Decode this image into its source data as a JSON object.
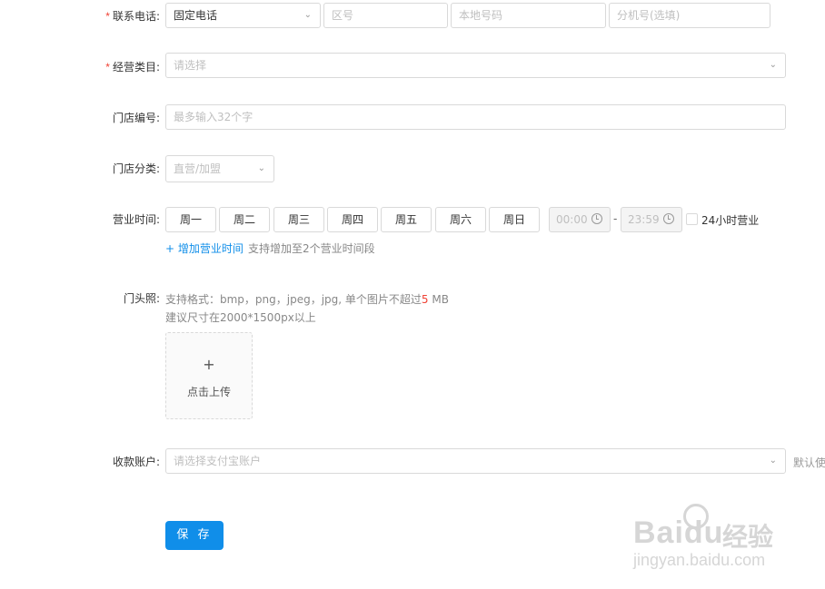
{
  "contact": {
    "label": "联系电话:",
    "required": "*",
    "type_value": "固定电话",
    "area_placeholder": "区号",
    "local_placeholder": "本地号码",
    "ext_placeholder": "分机号(选填)"
  },
  "category": {
    "label": "经营类目:",
    "required": "*",
    "placeholder": "请选择"
  },
  "store_number": {
    "label": "门店编号:",
    "placeholder": "最多输入32个字"
  },
  "store_type": {
    "label": "门店分类:",
    "placeholder": "直营/加盟"
  },
  "hours": {
    "label": "营业时间:",
    "days": [
      "周一",
      "周二",
      "周三",
      "周四",
      "周五",
      "周六",
      "周日"
    ],
    "start": "00:00",
    "dash": "-",
    "end": "23:59",
    "all_day_label": "24小时营业",
    "add_link": "+ 增加营业时间",
    "add_hint": "支持增加至2个营业时间段"
  },
  "photo": {
    "label": "门头照:",
    "format_hint_prefix": "支持格式：bmp，png，jpeg，jpg, 单个图片不超过",
    "format_hint_size": "5",
    "format_hint_suffix": " MB",
    "size_hint": "建议尺寸在2000*1500px以上",
    "upload_plus": "+",
    "upload_label": "点击上传"
  },
  "account": {
    "label": "收款账户:",
    "placeholder": "请选择支付宝账户",
    "default_text": "默认使"
  },
  "save_label": "保 存",
  "watermark": {
    "brand": "Baidu",
    "brand_cn": "经验",
    "url": "jingyan.baidu.com"
  }
}
